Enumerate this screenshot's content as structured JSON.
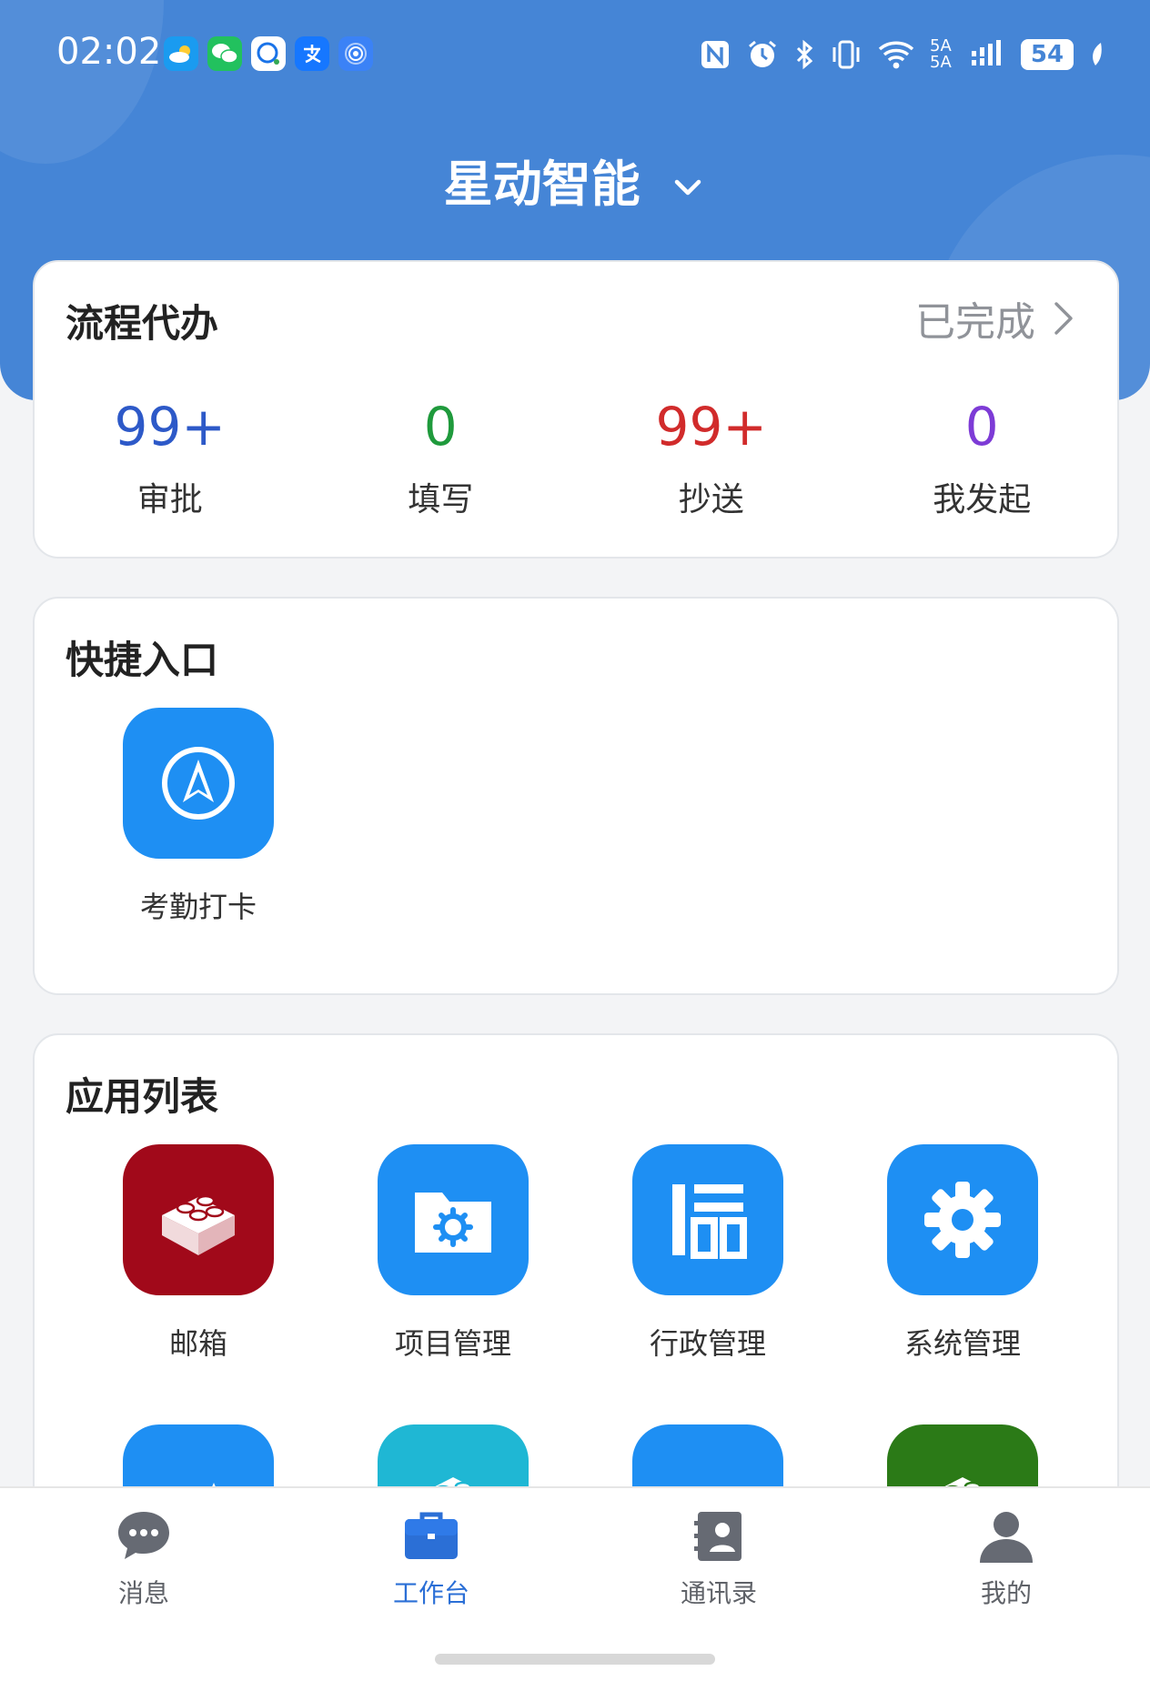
{
  "status": {
    "time": "02:02",
    "battery": "54",
    "signal": "5A 5A"
  },
  "header": {
    "org_name": "星动智能"
  },
  "todo": {
    "title": "流程代办",
    "done_link": "已完成",
    "stats": [
      {
        "value": "99+",
        "label": "审批",
        "color": "#2d59c8"
      },
      {
        "value": "0",
        "label": "填写",
        "color": "#1f9a3c"
      },
      {
        "value": "99+",
        "label": "抄送",
        "color": "#d12b2b"
      },
      {
        "value": "0",
        "label": "我发起",
        "color": "#7d3bd6"
      }
    ]
  },
  "quick": {
    "title": "快捷入口",
    "items": [
      {
        "label": "考勤打卡",
        "icon": "navigation-icon",
        "color": "#1e8ff3"
      }
    ]
  },
  "apps": {
    "title": "应用列表",
    "items": [
      {
        "label": "邮箱",
        "icon": "blocks-icon",
        "color": "#a1091a"
      },
      {
        "label": "项目管理",
        "icon": "folder-gear-icon",
        "color": "#1e8ff3"
      },
      {
        "label": "行政管理",
        "icon": "columns-icon",
        "color": "#1e8ff3"
      },
      {
        "label": "系统管理",
        "icon": "gear-icon",
        "color": "#1e8ff3"
      }
    ],
    "partial_colors": [
      "#1e8ff3",
      "#1fb7d4",
      "#1e8ff3",
      "#2b7a17"
    ]
  },
  "tabs": [
    {
      "label": "消息",
      "icon": "chat-bubble-icon",
      "active": false
    },
    {
      "label": "工作台",
      "icon": "briefcase-icon",
      "active": true
    },
    {
      "label": "通讯录",
      "icon": "contacts-icon",
      "active": false
    },
    {
      "label": "我的",
      "icon": "person-icon",
      "active": false
    }
  ],
  "colors": {
    "brand": "#4585d6",
    "active_tab": "#2b6fd6"
  }
}
